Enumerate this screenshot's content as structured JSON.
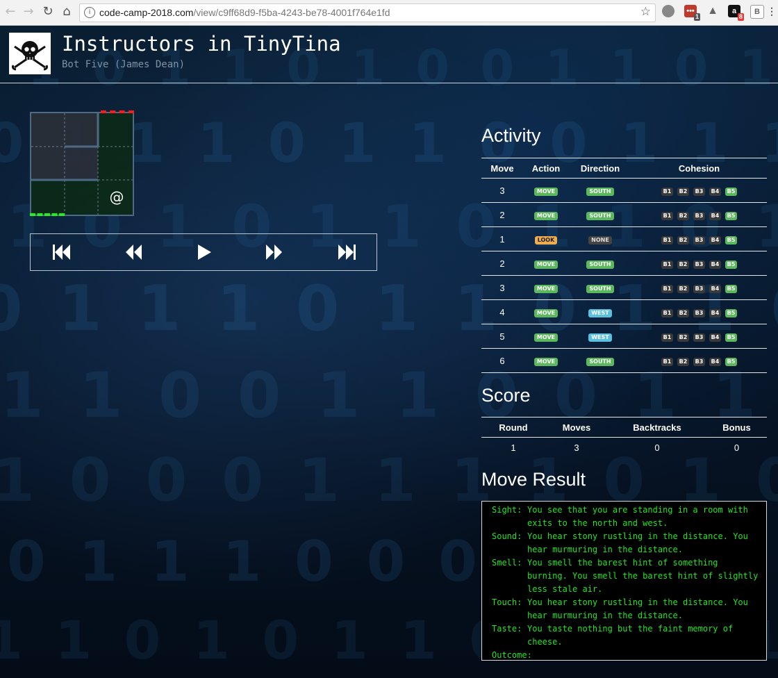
{
  "browser": {
    "url_host": "code-camp-2018.com",
    "url_path": "/view/c9ff68d9-f5ba-4243-be78-4001f764e1fd",
    "ext_badges": [
      "1",
      "8"
    ]
  },
  "header": {
    "title": "Instructors in TinyTina",
    "subtitle": "Bot Five (James Dean)"
  },
  "maze": {
    "bot_marker": "@"
  },
  "activity": {
    "heading": "Activity",
    "columns": {
      "move": "Move",
      "action": "Action",
      "direction": "Direction",
      "cohesion": "Cohesion"
    },
    "rows": [
      {
        "move": "3",
        "action": "MOVE",
        "action_style": "move",
        "direction": "SOUTH",
        "direction_style": "south",
        "b5_active": true
      },
      {
        "move": "2",
        "action": "MOVE",
        "action_style": "move",
        "direction": "SOUTH",
        "direction_style": "south",
        "b5_active": true
      },
      {
        "move": "1",
        "action": "LOOK",
        "action_style": "look",
        "direction": "NONE",
        "direction_style": "none",
        "b5_active": true
      },
      {
        "move": "2",
        "action": "MOVE",
        "action_style": "move",
        "direction": "SOUTH",
        "direction_style": "south",
        "b5_active": true
      },
      {
        "move": "3",
        "action": "MOVE",
        "action_style": "move",
        "direction": "SOUTH",
        "direction_style": "south",
        "b5_active": true
      },
      {
        "move": "4",
        "action": "MOVE",
        "action_style": "move",
        "direction": "WEST",
        "direction_style": "west",
        "b5_active": true
      },
      {
        "move": "5",
        "action": "MOVE",
        "action_style": "move",
        "direction": "WEST",
        "direction_style": "west",
        "b5_active": true
      },
      {
        "move": "6",
        "action": "MOVE",
        "action_style": "move",
        "direction": "SOUTH",
        "direction_style": "south",
        "b5_active": true
      }
    ],
    "bots": [
      "B1",
      "B2",
      "B3",
      "B4",
      "B5"
    ]
  },
  "score": {
    "heading": "Score",
    "columns": {
      "round": "Round",
      "moves": "Moves",
      "backtracks": "Backtracks",
      "bonus": "Bonus"
    },
    "values": {
      "round": "1",
      "moves": "3",
      "backtracks": "0",
      "bonus": "0"
    }
  },
  "result": {
    "heading": "Move Result",
    "lines": [
      {
        "key": "Sight:",
        "text": "You see that you are standing in a room with exits to the north and west."
      },
      {
        "key": "Sound:",
        "text": "You hear stony rustling in the distance. You hear murmuring in the distance."
      },
      {
        "key": "Smell:",
        "text": "You smell the barest hint of something burning. You smell the barest hint of slightly less stale air."
      },
      {
        "key": "Touch:",
        "text": "You hear stony rustling in the distance. You hear murmuring in the distance."
      },
      {
        "key": "Taste:",
        "text": "You taste nothing but the faint memory of cheese."
      },
      {
        "key": "Outcome:",
        "text": ""
      }
    ]
  },
  "colors": {
    "move_label": "#5cb85c",
    "look_label": "#f0ad4e",
    "west_label": "#5bc0de",
    "result_text": "#1fe51f",
    "exit_red": "#ff1a1a",
    "exit_green": "#22ee22"
  },
  "icons": {
    "logo": "skull-crossed-swords-icon",
    "controls": [
      "skip-back-icon",
      "rewind-icon",
      "play-icon",
      "fast-forward-icon",
      "skip-forward-icon"
    ]
  }
}
